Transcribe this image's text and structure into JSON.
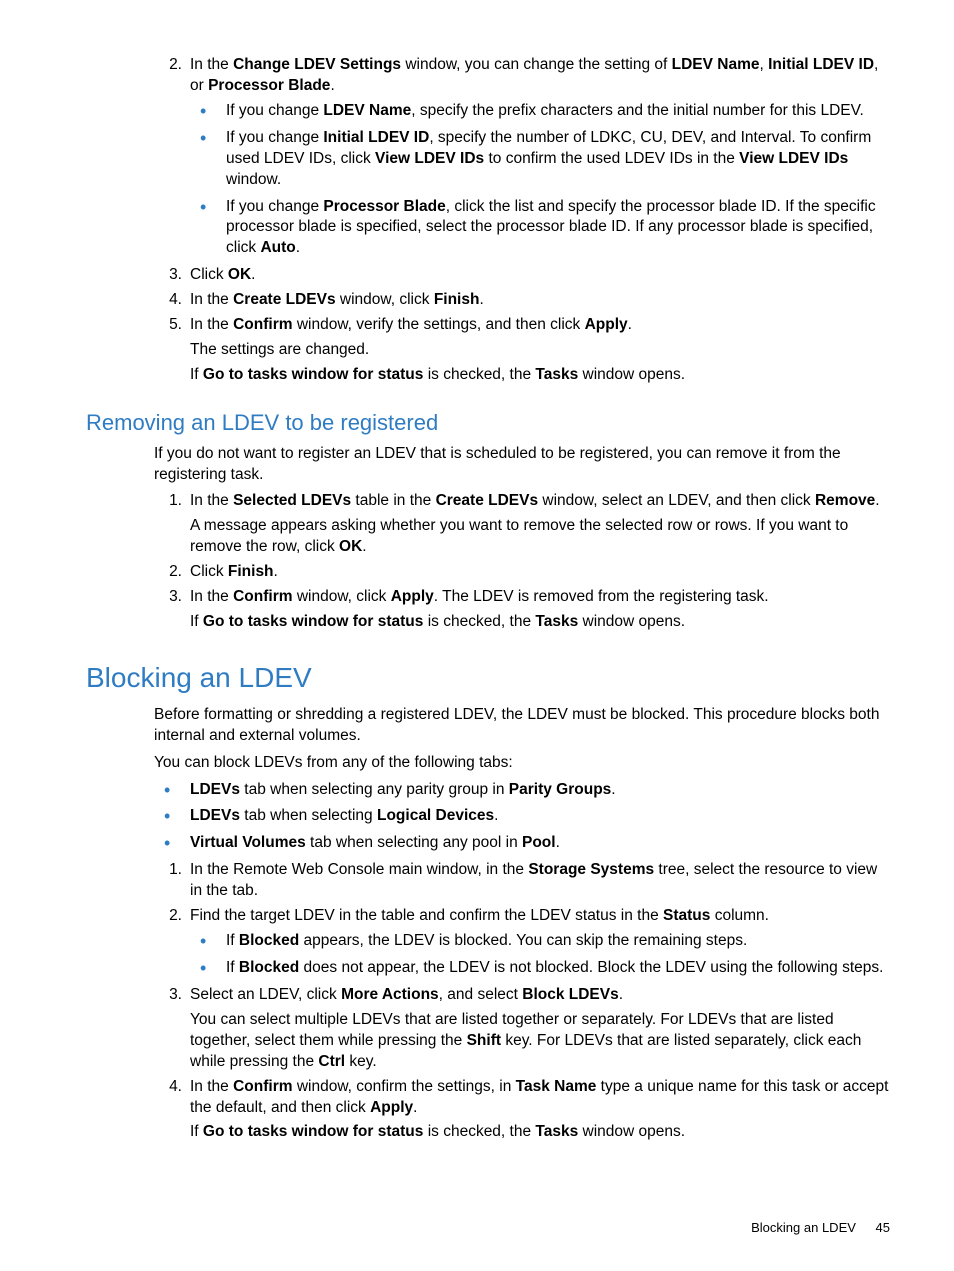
{
  "sec1": {
    "li2": {
      "num": "2.",
      "t1": "In the ",
      "b1": "Change LDEV Settings",
      "t2": " window, you can change the setting of ",
      "b2": "LDEV Name",
      "t3": ", ",
      "b3": "Initial LDEV ID",
      "t4": ", or ",
      "b4": "Processor Blade",
      "t5": ".",
      "sub": {
        "s1": {
          "t1": "If you change ",
          "b1": "LDEV Name",
          "t2": ", specify the prefix characters and the initial number for this LDEV."
        },
        "s2": {
          "t1": "If you change ",
          "b1": "Initial LDEV ID",
          "t2": ", specify the number of LDKC, CU, DEV, and Interval. To confirm used LDEV IDs, click ",
          "b2": "View LDEV IDs",
          "t3": " to confirm the used LDEV IDs in the ",
          "b3": "View LDEV IDs",
          "t4": " window."
        },
        "s3": {
          "t1": "If you change ",
          "b1": "Processor Blade",
          "t2": ", click the list and specify the processor blade ID. If the specific processor blade is specified, select the processor blade ID. If any processor blade is specified, click ",
          "b2": "Auto",
          "t3": "."
        }
      }
    },
    "li3": {
      "num": "3.",
      "t1": "Click ",
      "b1": "OK",
      "t2": "."
    },
    "li4": {
      "num": "4.",
      "t1": "In the ",
      "b1": "Create LDEVs",
      "t2": " window, click ",
      "b2": "Finish",
      "t3": "."
    },
    "li5": {
      "num": "5.",
      "t1": "In the ",
      "b1": "Confirm",
      "t2": " window, verify the settings, and then click ",
      "b2": "Apply",
      "t3": ".",
      "p1": "The settings are changed.",
      "p2": {
        "t1": "If ",
        "b1": "Go to tasks window for status",
        "t2": " is checked, the ",
        "b2": "Tasks",
        "t3": " window opens."
      }
    }
  },
  "sec2": {
    "heading": "Removing an LDEV to be registered",
    "intro": "If you do not want to register an LDEV that is scheduled to be registered, you can remove it from the registering task.",
    "li1": {
      "num": "1.",
      "t1": "In the ",
      "b1": "Selected LDEVs",
      "t2": " table in the ",
      "b2": "Create LDEVs",
      "t3": " window, select an LDEV, and then click ",
      "b3": "Remove",
      "t4": ".",
      "p1": {
        "t1": "A message appears asking whether you want to remove the selected row or rows. If you want to remove the row, click ",
        "b1": "OK",
        "t2": "."
      }
    },
    "li2": {
      "num": "2.",
      "t1": "Click ",
      "b1": "Finish",
      "t2": "."
    },
    "li3": {
      "num": "3.",
      "t1": "In the ",
      "b1": "Confirm",
      "t2": " window, click ",
      "b2": "Apply",
      "t3": ". The LDEV is removed from the registering task.",
      "p1": {
        "t1": "If ",
        "b1": "Go to tasks window for status",
        "t2": " is checked, the ",
        "b2": "Tasks",
        "t3": " window opens."
      }
    }
  },
  "sec3": {
    "heading": "Blocking an LDEV",
    "intro1": "Before formatting or shredding a registered LDEV, the LDEV must be blocked. This procedure blocks both internal and external volumes.",
    "intro2": "You can block LDEVs from any of the following tabs:",
    "bul": {
      "b1": {
        "b1": "LDEVs",
        "t1": " tab when selecting any parity group in ",
        "b2": "Parity Groups",
        "t2": "."
      },
      "b2": {
        "b1": "LDEVs",
        "t1": " tab when selecting ",
        "b2": "Logical Devices",
        "t2": "."
      },
      "b3": {
        "b1": "Virtual Volumes",
        "t1": " tab when selecting any pool in ",
        "b2": "Pool",
        "t2": "."
      }
    },
    "li1": {
      "num": "1.",
      "t1": "In the Remote Web Console main window, in the ",
      "b1": "Storage Systems",
      "t2": " tree, select the resource to view in the tab."
    },
    "li2": {
      "num": "2.",
      "t1": "Find the target LDEV in the table and confirm the LDEV status in the ",
      "b1": "Status",
      "t2": " column.",
      "sub": {
        "s1": {
          "t1": "If ",
          "b1": "Blocked",
          "t2": " appears, the LDEV is blocked. You can skip the remaining steps."
        },
        "s2": {
          "t1": "If ",
          "b1": "Blocked",
          "t2": " does not appear, the LDEV is not blocked. Block the LDEV using the following steps."
        }
      }
    },
    "li3": {
      "num": "3.",
      "t1": "Select an LDEV, click ",
      "b1": "More Actions",
      "t2": ", and select ",
      "b2": "Block LDEVs",
      "t3": ".",
      "p1": {
        "t1": "You can select multiple LDEVs that are listed together or separately. For LDEVs that are listed together, select them while pressing the ",
        "b1": "Shift",
        "t2": " key. For LDEVs that are listed separately, click each while pressing the ",
        "b2": "Ctrl",
        "t3": " key."
      }
    },
    "li4": {
      "num": "4.",
      "t1": "In the ",
      "b1": "Confirm",
      "t2": " window, confirm the settings, in ",
      "b2": "Task Name",
      "t3": " type a unique name for this task or accept the default, and then click ",
      "b3": "Apply",
      "t4": ".",
      "p1": {
        "t1": "If ",
        "b1": "Go to tasks window for status",
        "t2": " is checked, the ",
        "b2": "Tasks",
        "t3": " window opens."
      }
    }
  },
  "footer": {
    "title": "Blocking an LDEV",
    "page": "45"
  }
}
